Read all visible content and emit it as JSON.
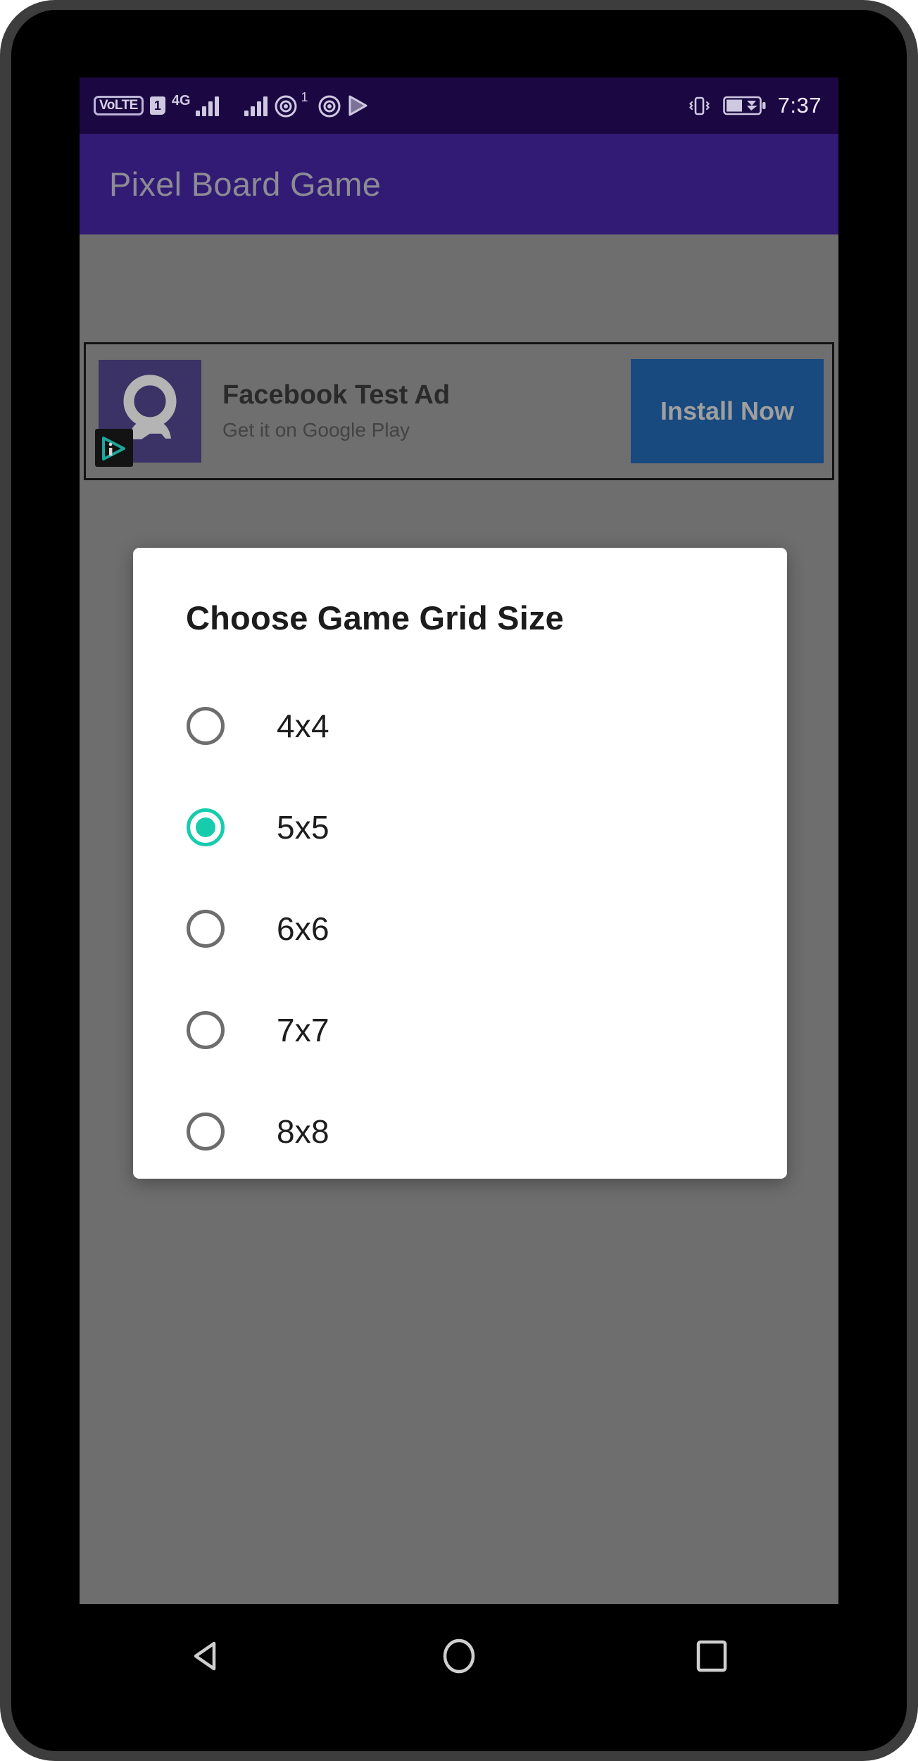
{
  "status_bar": {
    "volte_label": "VoLTE",
    "sim_indicator": "1",
    "network_label": "4G",
    "hotspot_superscript": "1",
    "icons": [
      "volte-badge",
      "sim-1-badge",
      "signal-bars-4g",
      "signal-bars-secondary",
      "wireless-icon-1",
      "wireless-icon-2",
      "play-store-icon",
      "vibrate-icon",
      "battery-charging-icon"
    ],
    "time": "7:37",
    "background_color": "#1b0742"
  },
  "app_bar": {
    "title": "Pixel Board Game",
    "background_color": "#311b75",
    "title_color": "#8d8b93"
  },
  "ad_banner": {
    "title": "Facebook Test Ad",
    "subtitle": "Get it on Google Play",
    "cta_label": "Install Now",
    "cta_color": "#18497f",
    "icon_name": "advertiser-avatar-icon",
    "adchoices_icon": "adchoices-icon"
  },
  "dialog": {
    "title": "Choose Game Grid Size",
    "selected_value": "5x5",
    "accent_color": "#17ccad",
    "options": [
      {
        "label": "4x4",
        "selected": false
      },
      {
        "label": "5x5",
        "selected": true
      },
      {
        "label": "6x6",
        "selected": false
      },
      {
        "label": "7x7",
        "selected": false
      },
      {
        "label": "8x8",
        "selected": false
      }
    ]
  },
  "nav_bar": {
    "buttons": [
      {
        "name": "back",
        "icon": "triangle-back-icon"
      },
      {
        "name": "home",
        "icon": "circle-home-icon"
      },
      {
        "name": "recents",
        "icon": "square-recents-icon"
      }
    ]
  },
  "scrim": {
    "color": "#6e6e6e"
  }
}
